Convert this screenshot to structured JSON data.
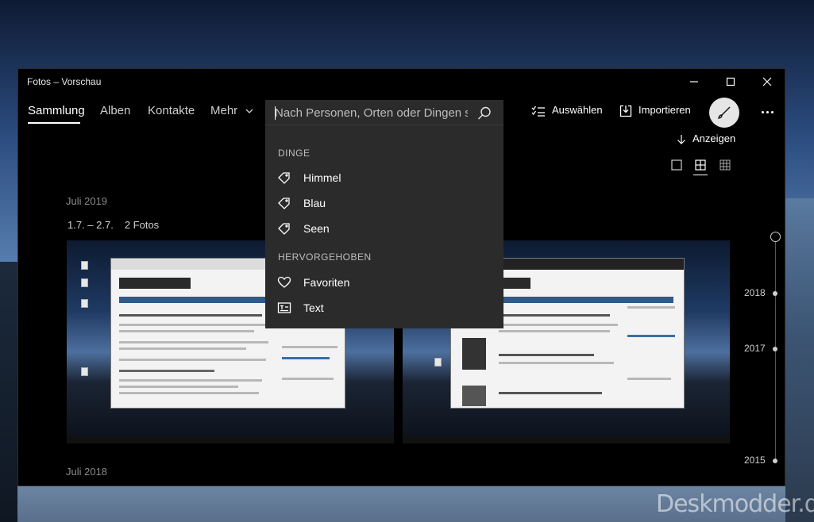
{
  "window": {
    "title": "Fotos – Vorschau"
  },
  "nav": {
    "items": [
      {
        "label": "Sammlung",
        "active": true
      },
      {
        "label": "Alben"
      },
      {
        "label": "Kontakte"
      },
      {
        "label": "Mehr"
      }
    ]
  },
  "search": {
    "placeholder": "Nach Personen, Orten oder Dingen suchen",
    "icon": "search-icon"
  },
  "dropdown": {
    "groups": [
      {
        "header": "DINGE",
        "items": [
          {
            "label": "Himmel",
            "icon": "tag-icon"
          },
          {
            "label": "Blau",
            "icon": "tag-icon"
          },
          {
            "label": "Seen",
            "icon": "tag-icon"
          }
        ]
      },
      {
        "header": "HERVORGEHOBEN",
        "items": [
          {
            "label": "Favoriten",
            "icon": "heart-icon"
          },
          {
            "label": "Text",
            "icon": "text-icon"
          }
        ]
      }
    ]
  },
  "toolbar": {
    "select_label": "Auswählen",
    "import_label": "Importieren",
    "view_label": "Anzeigen"
  },
  "content": {
    "months": [
      "Juli 2019",
      "Juli 2018"
    ],
    "range": "1.7. – 2.7.",
    "count": "2 Fotos"
  },
  "timeline": {
    "years": [
      "2018",
      "2017",
      "2015"
    ]
  },
  "watermark": "Deskmodder.de",
  "colors": {
    "background": "#000000",
    "dropdown": "#2b2b2b",
    "accent": "#ffffff"
  }
}
